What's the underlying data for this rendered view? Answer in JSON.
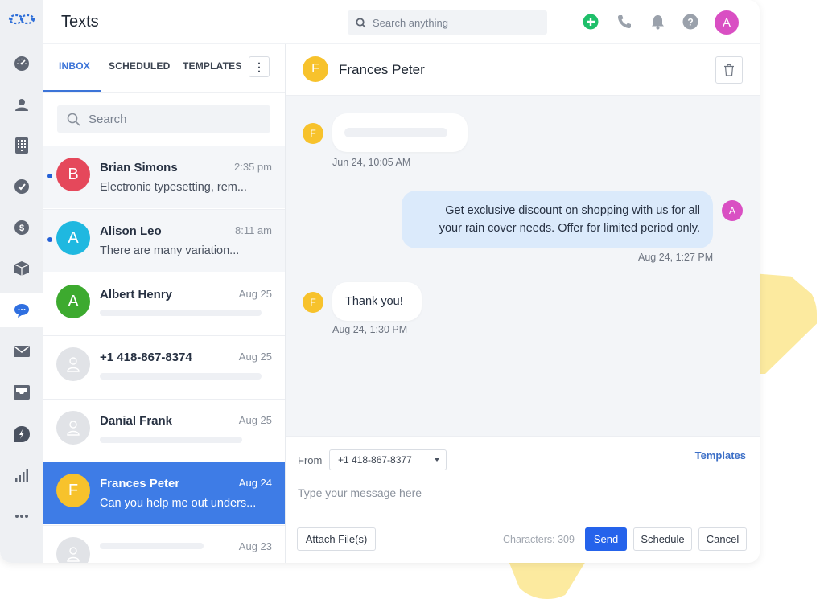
{
  "app": {
    "title": "Texts",
    "global_search_placeholder": "Search anything",
    "user_initial": "A",
    "colors": {
      "accent": "#3c74d8",
      "selected_row": "#3e7ce6",
      "primary_button": "#2563eb",
      "add_icon": "#1fbf6a",
      "user_avatar": "#d94fc3",
      "highlight_shape": "#fcea9f"
    }
  },
  "rail": {
    "logo": "app-logo",
    "items": [
      {
        "icon": "dashboard-icon",
        "active": false
      },
      {
        "icon": "contacts-icon",
        "active": false
      },
      {
        "icon": "dialpad-icon",
        "active": false
      },
      {
        "icon": "tasks-icon",
        "active": false
      },
      {
        "icon": "billing-icon",
        "active": false
      },
      {
        "icon": "package-icon",
        "active": false
      },
      {
        "icon": "texts-icon",
        "active": true
      },
      {
        "icon": "email-icon",
        "active": false
      },
      {
        "icon": "inbox-icon",
        "active": false
      },
      {
        "icon": "power-dialer-icon",
        "active": false
      },
      {
        "icon": "reports-icon",
        "active": false
      },
      {
        "icon": "more-icon",
        "active": false
      }
    ]
  },
  "header_icons": [
    "add-icon",
    "phone-icon",
    "bell-icon",
    "help-icon"
  ],
  "list": {
    "tabs": [
      {
        "label": "INBOX",
        "active": true
      },
      {
        "label": "SCHEDULED",
        "active": false
      },
      {
        "label": "TEMPLATES",
        "active": false
      }
    ],
    "more_label": "⋮",
    "search_placeholder": "Search",
    "conversations": [
      {
        "initial": "B",
        "name": "Brian Simons",
        "time": "2:35 pm",
        "preview": "Electronic typesetting, rem...",
        "unread": true,
        "avatar_color": "#e5485b"
      },
      {
        "initial": "A",
        "name": "Alison Leo",
        "time": "8:11 am",
        "preview": "There are many variation...",
        "unread": true,
        "avatar_color": "#1fb8e0"
      },
      {
        "initial": "A",
        "name": "Albert Henry",
        "time": "Aug 25",
        "preview": "",
        "unread": false,
        "avatar_color": "#3daa2f"
      },
      {
        "initial": "",
        "name": "+1 418-867-8374",
        "time": "Aug 25",
        "preview": "",
        "unread": false,
        "avatar_color": "#e1e3e7"
      },
      {
        "initial": "",
        "name": "Danial Frank",
        "time": "Aug 25",
        "preview": "",
        "unread": false,
        "avatar_color": "#e1e3e7"
      },
      {
        "initial": "F",
        "name": "Frances Peter",
        "time": "Aug 24",
        "preview": "Can you help me out unders...",
        "unread": false,
        "selected": true,
        "avatar_color": "#f7c22c"
      },
      {
        "initial": "",
        "name": "",
        "time": "Aug 23",
        "preview": "",
        "unread": false,
        "avatar_color": "#e1e3e7"
      }
    ]
  },
  "chat": {
    "contact_initial": "F",
    "contact_name": "Frances Peter",
    "messages": [
      {
        "direction": "in",
        "initial": "F",
        "text": "",
        "timestamp": "Jun 24, 10:05 AM"
      },
      {
        "direction": "out",
        "initial": "A",
        "text": "Get exclusive discount on shopping with us for all your rain cover needs. Offer for limited period only.",
        "line1": "Get exclusive discount on shopping with us for all",
        "line2": "your rain cover needs. Offer for limited period only.",
        "timestamp": "Aug 24, 1:27 PM"
      },
      {
        "direction": "in",
        "initial": "F",
        "text": "Thank you!",
        "timestamp": "Aug 24, 1:30 PM"
      }
    ]
  },
  "compose": {
    "from_label": "From",
    "from_number": "+1 418-867-8377",
    "templates_link": "Templates",
    "message_placeholder": "Type your message here",
    "message_value": "",
    "attach_label": "Attach File(s)",
    "char_count": "Characters: 309",
    "send_label": "Send",
    "schedule_label": "Schedule",
    "cancel_label": "Cancel"
  }
}
